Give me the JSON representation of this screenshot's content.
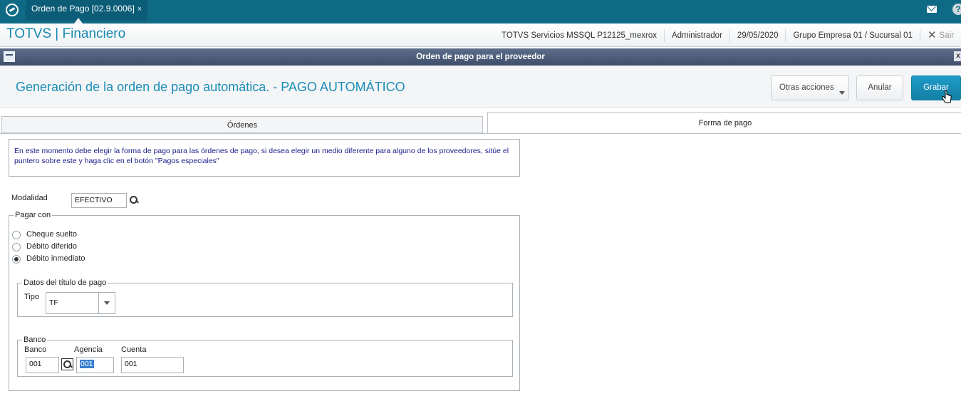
{
  "topbar": {
    "tab_label": "Orden de Pago [02.9.0006]",
    "tab_close": "×",
    "help": "?"
  },
  "appbar": {
    "title": "TOTVS | Financiero",
    "server": "TOTVS Servicios MSSQL P12125_mexrox",
    "user": "Administrador",
    "date": "29/05/2020",
    "company": "Grupo Empresa 01 / Sucursal 01",
    "close": "✕",
    "exit": "Sair"
  },
  "dialog": {
    "title": "Orden de pago para el proveedor",
    "close": "x"
  },
  "header": {
    "title": "Generación de la orden de pago automática. - PAGO AUTOMÁTICO",
    "otras_label": "Otras acciones",
    "anular_label": "Anular",
    "grabar_label": "Grabar"
  },
  "tabs": {
    "ordenes": "Órdenes",
    "forma": "Forma de pago"
  },
  "content": {
    "info_text": "En este momento debe elegir la forma de pago para las órdenes de pago, si desea elegir un medio diferente para alguno de los proveedores, sitúe el puntero sobre este y haga clic en el botón \"Pagos especiales\"",
    "modalidad_label": "Modalidad",
    "modalidad_value": "EFECTIVO",
    "pagar_con_legend": "Pagar con",
    "options": [
      {
        "label": "Cheque suelto",
        "selected": false
      },
      {
        "label": "Débito diferido",
        "selected": false
      },
      {
        "label": "Débito inmediato",
        "selected": true
      }
    ],
    "datos_legend": "Datos del título de pago",
    "tipo_label": "Tipo",
    "tipo_value": "TF",
    "banco_legend": "Banco",
    "banco_label": "Banco",
    "banco_value": "001",
    "agencia_label": "Agencia",
    "agencia_value": "001",
    "cuenta_label": "Cuenta",
    "cuenta_value": "001"
  }
}
